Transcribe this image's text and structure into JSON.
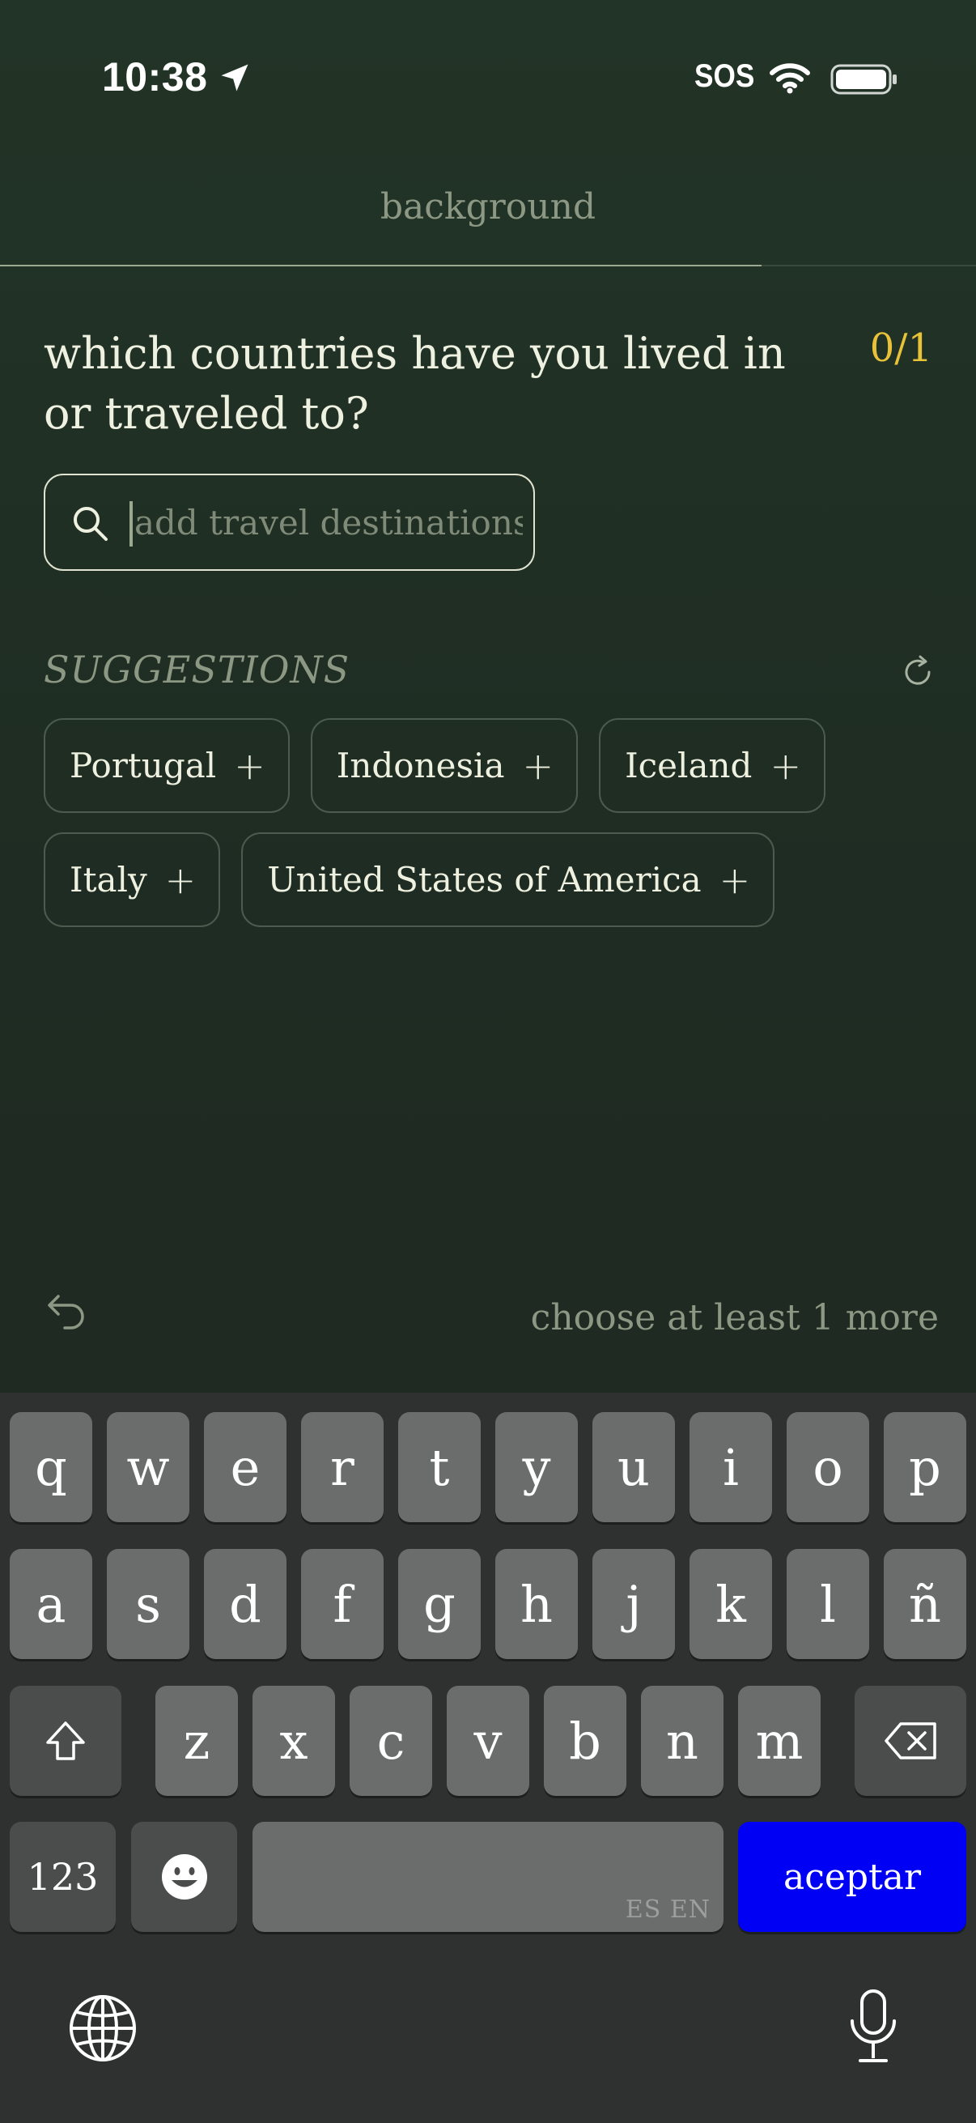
{
  "status_bar": {
    "time": "10:38",
    "sos": "SOS",
    "icons": [
      "location-arrow-icon",
      "wifi-icon",
      "battery-icon"
    ]
  },
  "header": {
    "section_title": "background",
    "progress": 0.78
  },
  "question": {
    "text": "which countries have you lived in or traveled to?",
    "counter": "0/1"
  },
  "search": {
    "placeholder": "add travel destinations",
    "value": ""
  },
  "suggestions": {
    "label": "SUGGESTIONS",
    "items": [
      "Portugal",
      "Indonesia",
      "Iceland",
      "Italy",
      "United States of America"
    ],
    "add_symbol": "+"
  },
  "footer": {
    "hint": "choose at least 1 more"
  },
  "keyboard": {
    "row1": [
      "q",
      "w",
      "e",
      "r",
      "t",
      "y",
      "u",
      "i",
      "o",
      "p"
    ],
    "row2": [
      "a",
      "s",
      "d",
      "f",
      "g",
      "h",
      "j",
      "k",
      "l",
      "ñ"
    ],
    "row3": [
      "z",
      "x",
      "c",
      "v",
      "b",
      "n",
      "m"
    ],
    "numbers_key": "123",
    "space_languages": "ES EN",
    "accept_key": "aceptar"
  },
  "colors": {
    "background": "#223427",
    "accent_counter": "#e8c238",
    "accept_key": "#0000f5"
  }
}
